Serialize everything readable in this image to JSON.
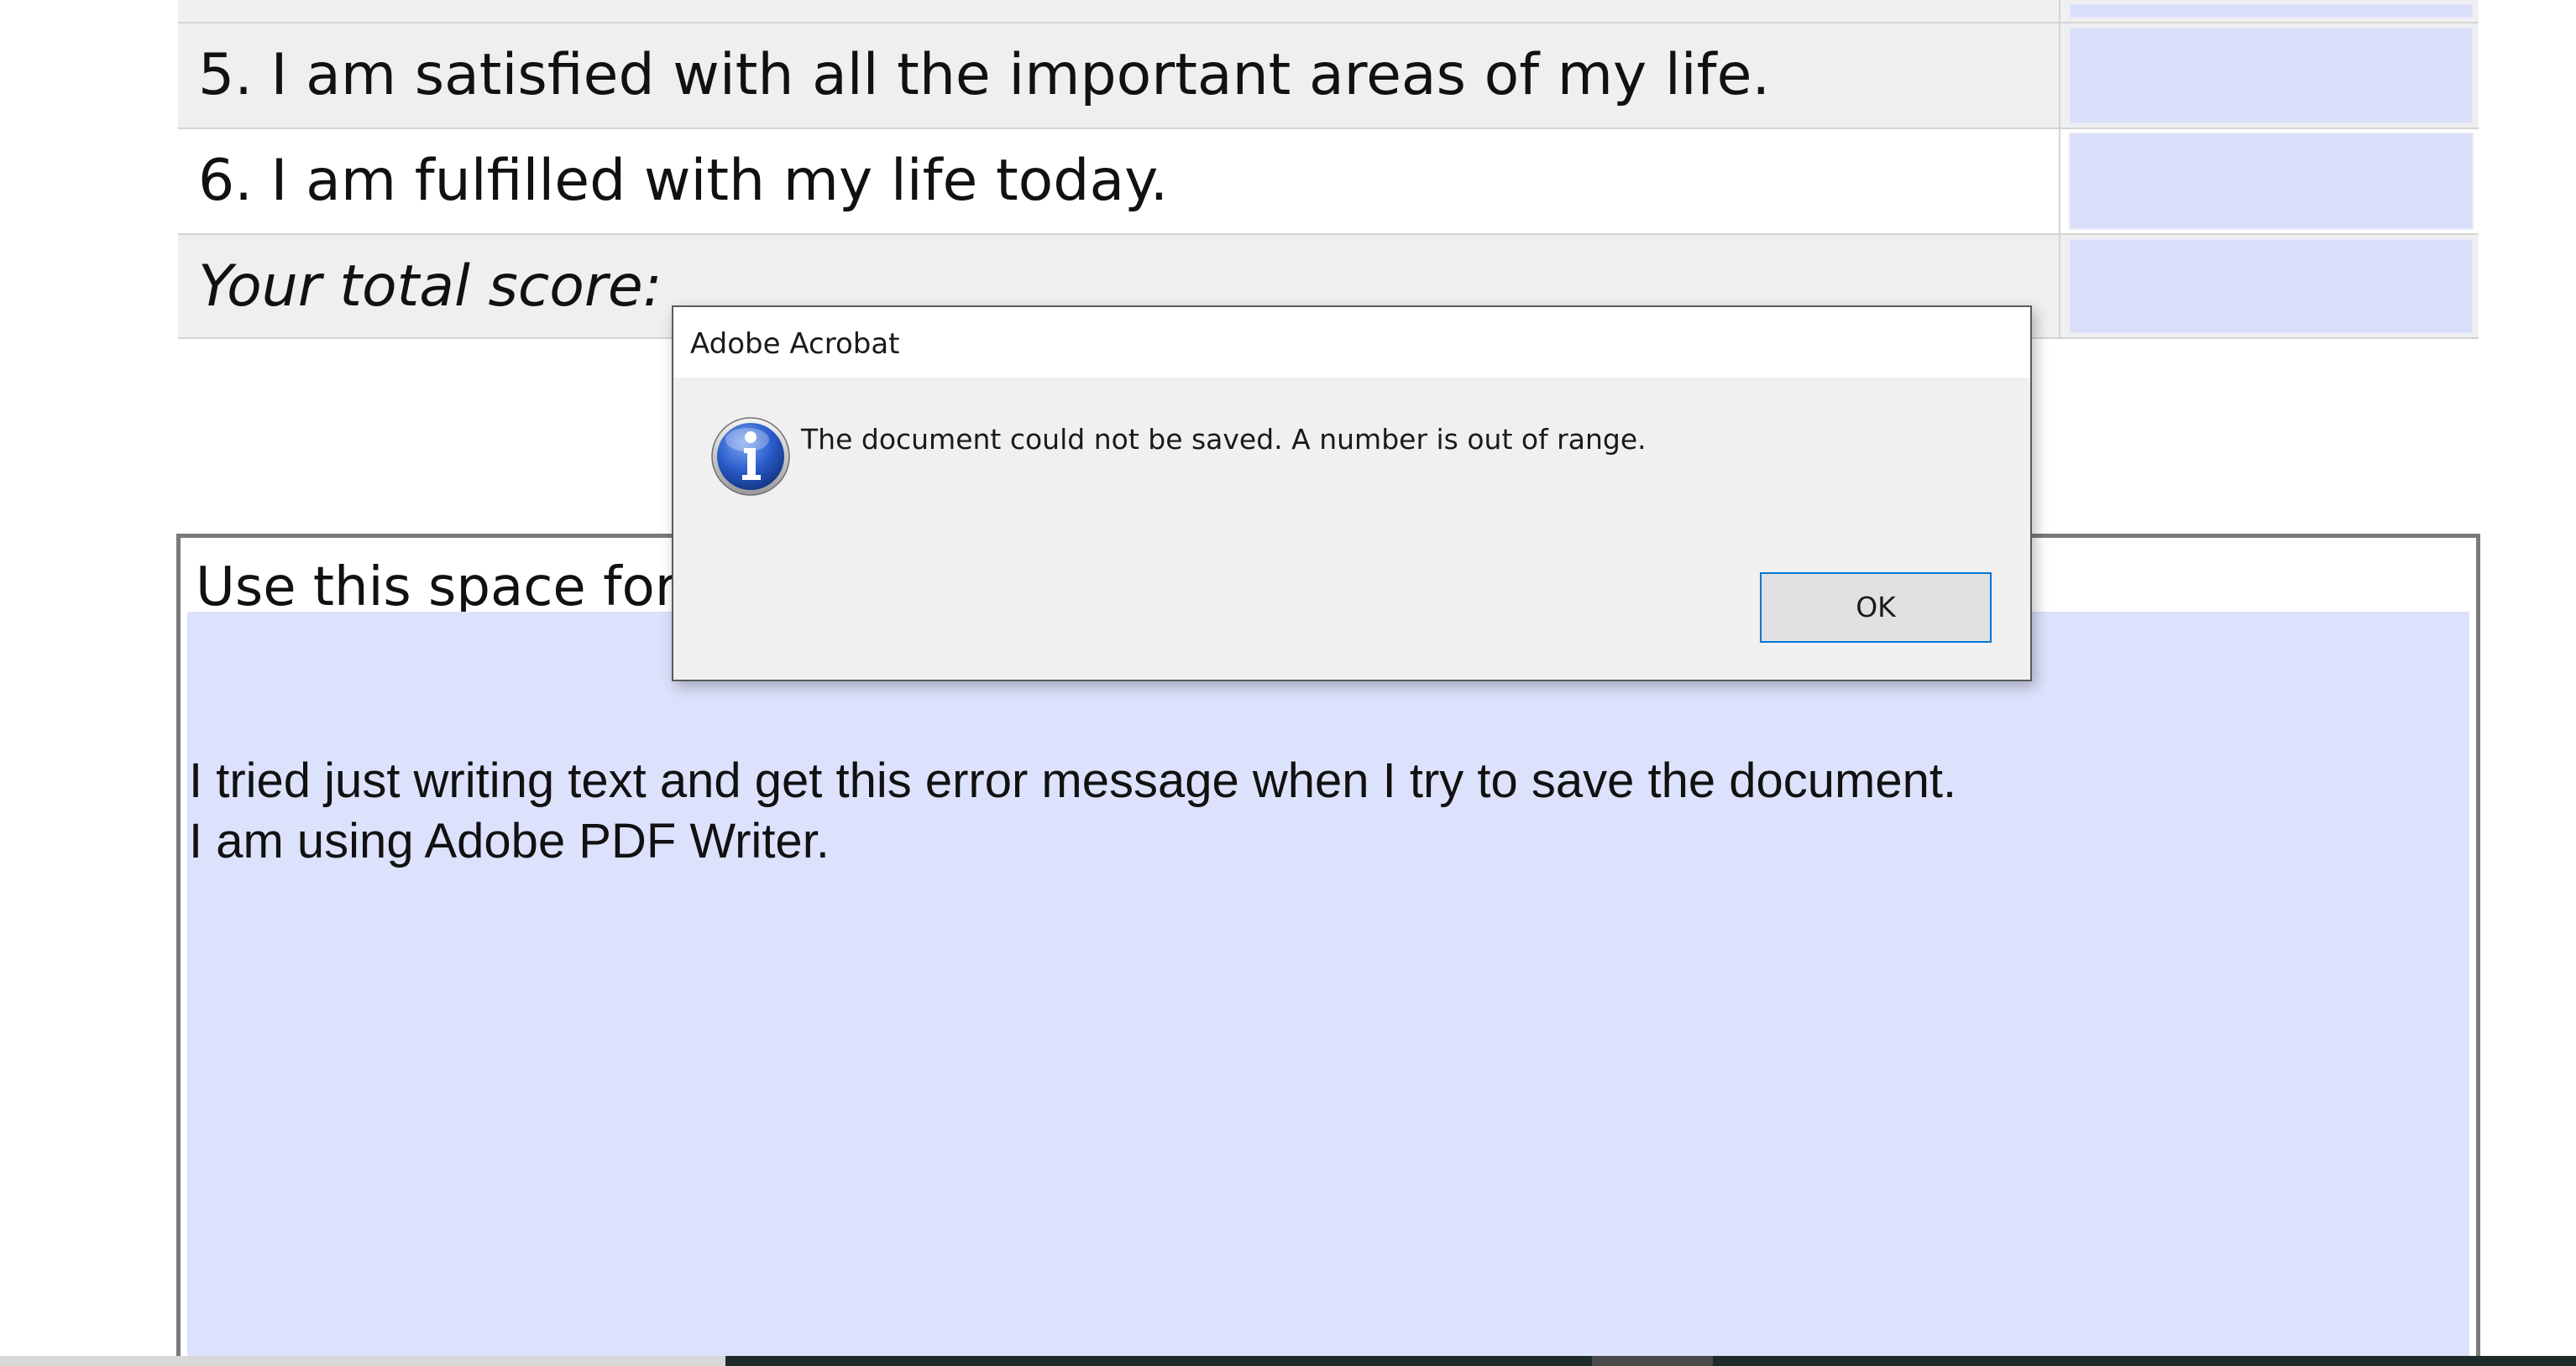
{
  "questionnaire": {
    "rows": [
      {
        "label": "5. I am satisfied with all the important areas of my life."
      },
      {
        "label": "6. I am fulfilled with my life today."
      }
    ],
    "total_label": "Your total score:"
  },
  "comments": {
    "title": "Use this space for",
    "lines": [
      "I tried just writing text and get this error message when I try to save the document.",
      "I am using Adobe PDF Writer."
    ]
  },
  "dialog": {
    "title": "Adobe Acrobat",
    "message": "The document could not be saved. A number is out of range.",
    "ok_label": "OK",
    "icon": "info-icon"
  },
  "colors": {
    "form_field": "#d9def9",
    "comments_field": "#dce2fc",
    "dialog_bg": "#f0f0f0",
    "button_focus": "#0078d7"
  }
}
